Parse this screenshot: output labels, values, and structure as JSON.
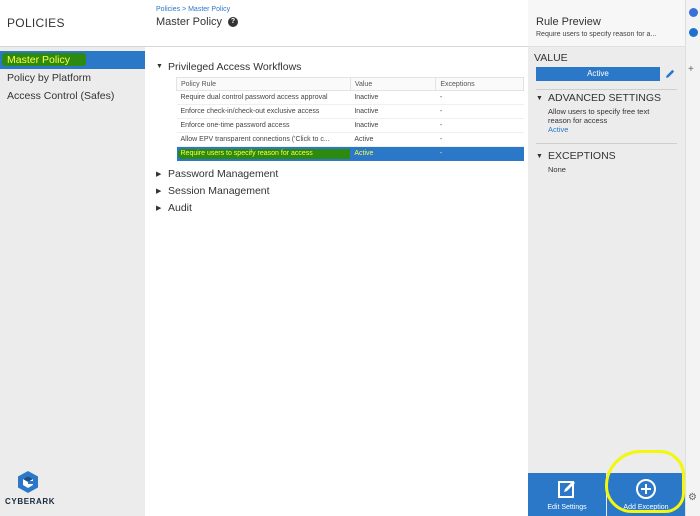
{
  "sidebar": {
    "title": "POLICIES",
    "items": [
      {
        "label": "Master Policy"
      },
      {
        "label": "Policy by Platform"
      },
      {
        "label": "Access Control (Safes)"
      }
    ],
    "logo_text": "CYBERARK"
  },
  "header": {
    "breadcrumb": "Policies > Master Policy",
    "title": "Master Policy",
    "help_glyph": "?"
  },
  "sections": [
    {
      "title": "Privileged Access Workflows",
      "expanded": true,
      "glyph": "▼"
    },
    {
      "title": "Password Management",
      "expanded": false,
      "glyph": "▶"
    },
    {
      "title": "Session Management",
      "expanded": false,
      "glyph": "▶"
    },
    {
      "title": "Audit",
      "expanded": false,
      "glyph": "▶"
    }
  ],
  "table": {
    "headers": [
      "Policy Rule",
      "Value",
      "Exceptions"
    ],
    "rows": [
      {
        "rule": "Require dual control password access approval",
        "value": "Inactive",
        "exceptions": "-"
      },
      {
        "rule": "Enforce check-in/check-out exclusive access",
        "value": "Inactive",
        "exceptions": "-"
      },
      {
        "rule": "Enforce one-time password access",
        "value": "Inactive",
        "exceptions": "-"
      },
      {
        "rule": "Allow EPV transparent connections ('Click to c...",
        "value": "Active",
        "exceptions": "-"
      },
      {
        "rule": "Require users to specify reason for access",
        "value": "Active",
        "exceptions": "-"
      }
    ]
  },
  "rule_preview": {
    "title": "Rule Preview",
    "subtitle": "Require users to specify reason for a...",
    "value_label": "VALUE",
    "value": "Active",
    "advanced_title": "ADVANCED SETTINGS",
    "advanced_text": "Allow users to specify free text reason for access",
    "advanced_value": "Active",
    "exceptions_title": "EXCEPTIONS",
    "exceptions_value": "None",
    "edit_label": "Edit Settings",
    "add_label": "Add Exception"
  },
  "colors": {
    "accent": "#2b78c9",
    "highlight_green": "#2d8a10",
    "highlight_yellow_text": "#ffff40",
    "annotation_ring": "#f3f70d"
  },
  "icons": [
    "help-icon",
    "expand-triangle-icon",
    "collapse-triangle-icon",
    "pencil-icon",
    "edit-settings-icon",
    "add-exception-icon",
    "cyberark-logo-icon",
    "plus-icon",
    "settings-gear-icon"
  ]
}
